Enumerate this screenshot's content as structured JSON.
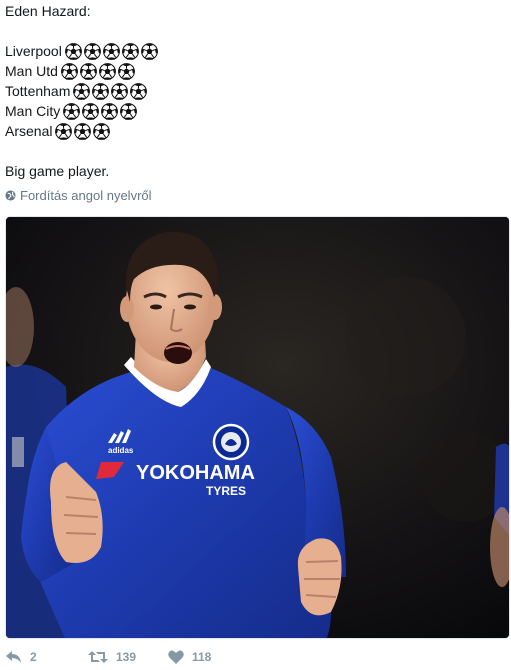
{
  "tweet": {
    "lines": [
      {
        "text": "Eden Hazard:",
        "balls": 0
      },
      {
        "text": "",
        "balls": 0
      },
      {
        "text": "Liverpool",
        "balls": 5
      },
      {
        "text": "Man Utd",
        "balls": 4
      },
      {
        "text": "Tottenham",
        "balls": 4
      },
      {
        "text": "Man City",
        "balls": 4
      },
      {
        "text": "Arsenal",
        "balls": 3
      },
      {
        "text": "",
        "balls": 0
      },
      {
        "text": "Big game player.",
        "balls": 0
      }
    ],
    "ball_icon": "soccer-ball-icon"
  },
  "translate": {
    "label": "Fordítás angol nyelvről",
    "icon": "globe-icon"
  },
  "media": {
    "sponsor": "YOKOHAMA",
    "sponsor_sub": "TYRES",
    "kit_brand": "adidas",
    "colors": {
      "kit": "#1f3fb8",
      "background": "#0a0a0c"
    }
  },
  "actions": {
    "reply_count": "2",
    "retweet_count": "139",
    "like_count": "118"
  },
  "colors": {
    "text": "#14171a",
    "muted": "#657786",
    "action": "#8899a6"
  }
}
